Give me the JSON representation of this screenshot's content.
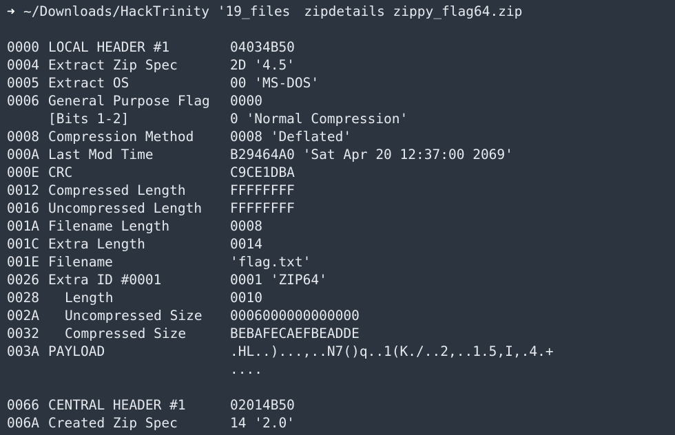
{
  "prompt": {
    "symbol": "➜",
    "cwd": "~/Downloads/HackTrinity '19_files",
    "command": "zipdetails zippy_flag64.zip"
  },
  "rows": [
    {
      "offset": "0000",
      "field": "LOCAL HEADER #1",
      "value": "04034B50",
      "indent": false
    },
    {
      "offset": "0004",
      "field": "Extract Zip Spec",
      "value": "2D '4.5'",
      "indent": false
    },
    {
      "offset": "0005",
      "field": "Extract OS",
      "value": "00 'MS-DOS'",
      "indent": false
    },
    {
      "offset": "0006",
      "field": "General Purpose Flag",
      "value": "0000",
      "indent": false
    },
    {
      "offset": "",
      "field": "[Bits 1-2]",
      "value": "0 'Normal Compression'",
      "indent": false
    },
    {
      "offset": "0008",
      "field": "Compression Method",
      "value": "0008 'Deflated'",
      "indent": false
    },
    {
      "offset": "000A",
      "field": "Last Mod Time",
      "value": "B29464A0 'Sat Apr 20 12:37:00 2069'",
      "indent": false
    },
    {
      "offset": "000E",
      "field": "CRC",
      "value": "C9CE1DBA",
      "indent": false
    },
    {
      "offset": "0012",
      "field": "Compressed Length",
      "value": "FFFFFFFF",
      "indent": false
    },
    {
      "offset": "0016",
      "field": "Uncompressed Length",
      "value": "FFFFFFFF",
      "indent": false
    },
    {
      "offset": "001A",
      "field": "Filename Length",
      "value": "0008",
      "indent": false
    },
    {
      "offset": "001C",
      "field": "Extra Length",
      "value": "0014",
      "indent": false
    },
    {
      "offset": "001E",
      "field": "Filename",
      "value": "'flag.txt'",
      "indent": false
    },
    {
      "offset": "0026",
      "field": "Extra ID #0001",
      "value": "0001 'ZIP64'",
      "indent": false
    },
    {
      "offset": "0028",
      "field": "Length",
      "value": "0010",
      "indent": true
    },
    {
      "offset": "002A",
      "field": "Uncompressed Size",
      "value": "0006000000000000",
      "indent": true
    },
    {
      "offset": "0032",
      "field": "Compressed Size",
      "value": "BEBAFECAEFBEADDE",
      "indent": true
    },
    {
      "offset": "003A",
      "field": "PAYLOAD",
      "value": ".HL..)...,..N7()q..1(K./..2,..1.5,I,.4.+",
      "indent": false
    },
    {
      "offset": "",
      "field": "",
      "value": "....",
      "indent": false
    }
  ],
  "rows2": [
    {
      "offset": "0066",
      "field": "CENTRAL HEADER #1",
      "value": "02014B50",
      "indent": false
    },
    {
      "offset": "006A",
      "field": "Created Zip Spec",
      "value": "14 '2.0'",
      "indent": false
    }
  ]
}
